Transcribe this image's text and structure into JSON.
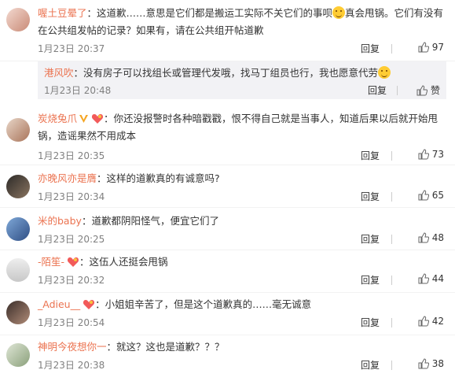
{
  "comments": [
    {
      "username": "喔土豆晕了",
      "text": "这道歉……意思是它们都是搬运工实际不关它们的事呗",
      "text_after_emoji": "真会甩锅。它们有没有在公共组发帖的记录？如果有，请在公共组开帖道歉",
      "time": "1月23日 20:37",
      "reply": "回复",
      "likes": "97"
    },
    {
      "username": "炭烧兔爪",
      "text": "你还没报警时各种暗戳戳，恨不得自己就是当事人，知道后果以后就开始甩锅，造谣果然不用成本",
      "time": "1月23日 20:35",
      "reply": "回复",
      "likes": "73"
    },
    {
      "username": "亦晚风亦是膺",
      "text": "这样的道歉真的有诚意吗?",
      "time": "1月23日 20:34",
      "reply": "回复",
      "likes": "65"
    },
    {
      "username": "米的baby",
      "text": "道歉都阴阳怪气，便宜它们了",
      "time": "1月23日 20:25",
      "reply": "回复",
      "likes": "48"
    },
    {
      "username": "-陌笙-",
      "text": "这伍人还挺会甩锅",
      "time": "1月23日 20:32",
      "reply": "回复",
      "likes": "44"
    },
    {
      "username": "_Adieu__",
      "text": "小姐姐辛苦了，但是这个道歉真的……毫无诚意",
      "time": "1月23日 20:54",
      "reply": "回复",
      "likes": "42"
    },
    {
      "username": "神明今夜想你一",
      "text": "就这？这也是道歉？？？",
      "time": "1月23日 20:38",
      "reply": "回复",
      "likes": "38"
    }
  ],
  "subreply": {
    "username": "港风吹",
    "text": "没有房子可以找组长或管理代发哦，找马丁组员也行，我也愿意代劳",
    "time": "1月23日 20:48",
    "reply": "回复",
    "likes": "赞"
  },
  "separator": "：",
  "colors": {
    "username": "#eb7350",
    "text": "#333333",
    "meta": "#808080",
    "subbox_bg": "#f2f2f5"
  }
}
